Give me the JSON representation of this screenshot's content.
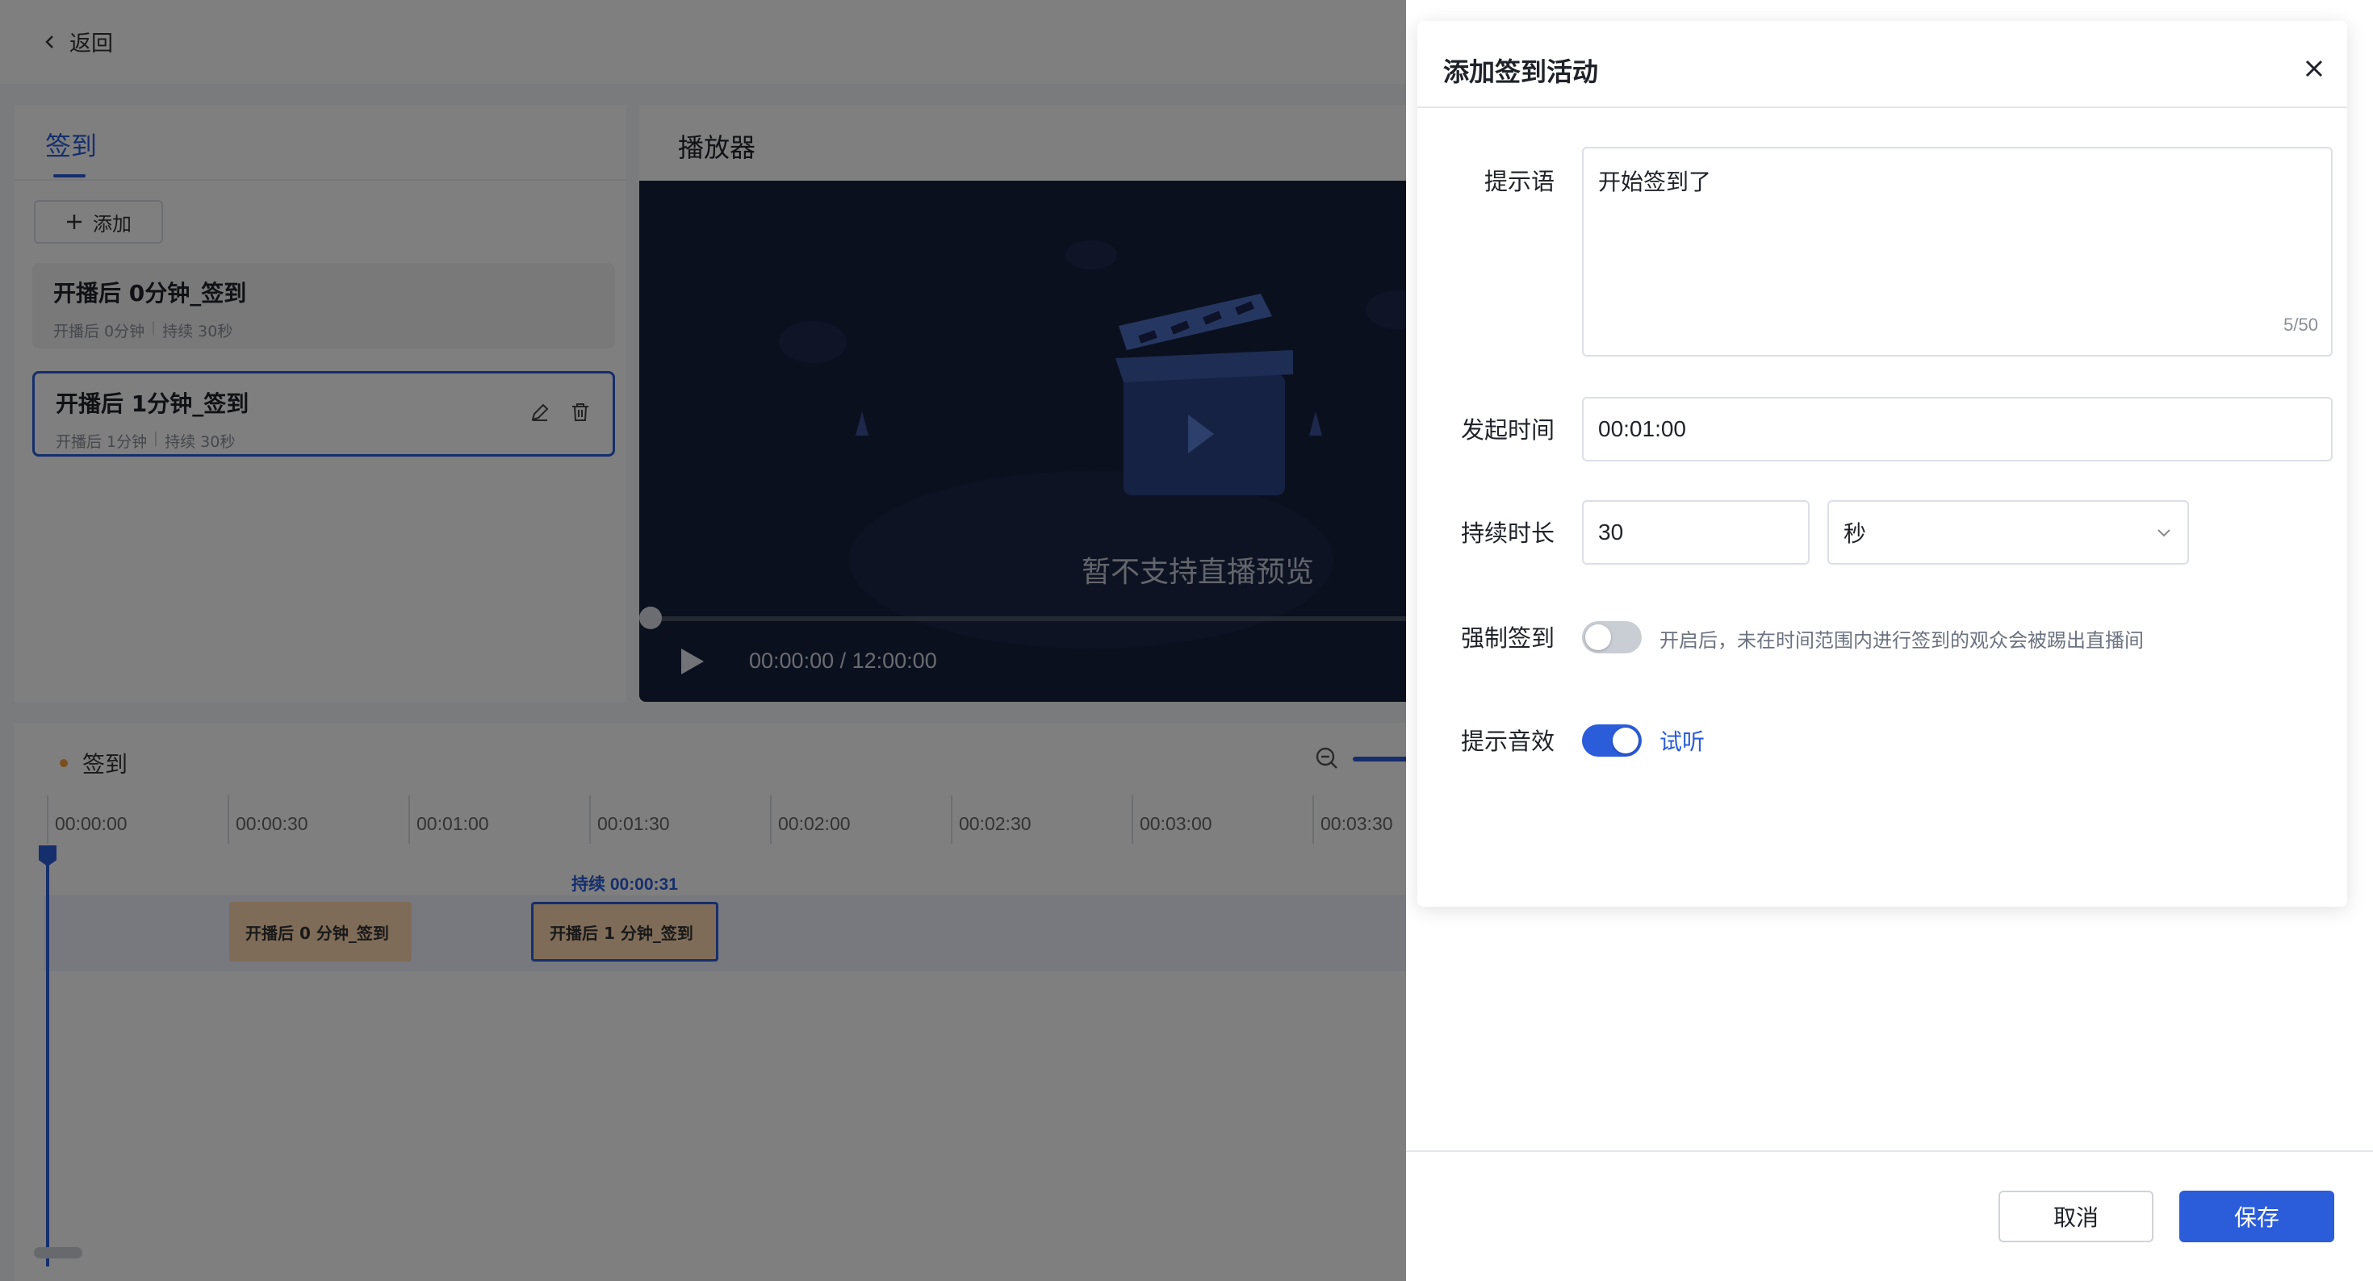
{
  "page": {
    "back_label": "返回"
  },
  "left_panel": {
    "tab_label": "签到",
    "add_label": "添加",
    "items": [
      {
        "title": "开播后 0分钟_签到",
        "start": "开播后 0分钟",
        "duration": "持续 30秒"
      },
      {
        "title": "开播后 1分钟_签到",
        "start": "开播后 1分钟",
        "duration": "持续 30秒"
      }
    ]
  },
  "player": {
    "title": "播放器",
    "message": "暂不支持直播预览",
    "time": "00:00:00 / 12:00:00"
  },
  "timeline": {
    "label": "签到",
    "ticks": [
      "00:00:00",
      "00:00:30",
      "00:01:00",
      "00:01:30",
      "00:02:00",
      "00:02:30",
      "00:03:00",
      "00:03:30"
    ],
    "segments": [
      {
        "label": "开播后 0 分钟_签到"
      },
      {
        "label": "开播后 1 分钟_签到"
      }
    ],
    "selected_duration": "持续 00:00:31"
  },
  "modal": {
    "title": "添加签到活动",
    "prompt_label": "提示语",
    "prompt_value": "开始签到了",
    "prompt_counter": "5/50",
    "start_time_label": "发起时间",
    "start_time_value": "00:01:00",
    "duration_label": "持续时长",
    "duration_value": "30",
    "duration_unit": "秒",
    "force_label": "强制签到",
    "force_on": false,
    "force_hint": "开启后，未在时间范围内进行签到的观众会被踢出直播间",
    "sound_label": "提示音效",
    "sound_on": true,
    "listen_label": "试听"
  },
  "footer": {
    "cancel_label": "取消",
    "save_label": "保存"
  },
  "colors": {
    "accent": "#2b5cd9",
    "segment_fill": "#ffd9b0",
    "video_bg": "#16203f"
  }
}
